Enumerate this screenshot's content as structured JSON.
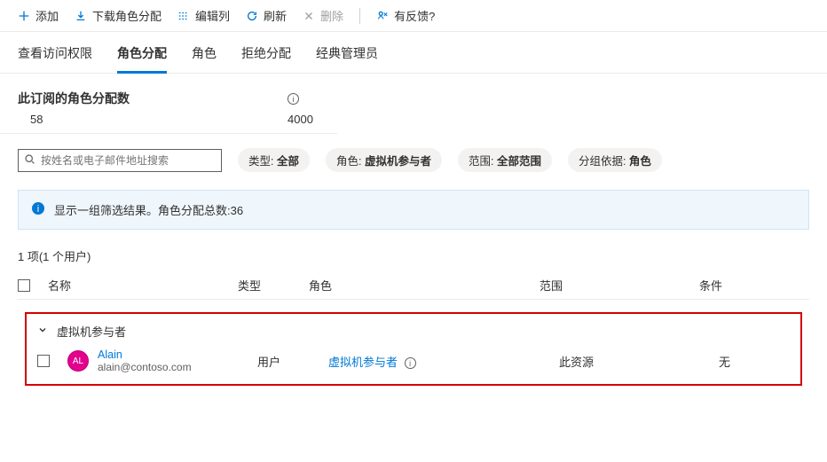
{
  "toolbar": {
    "add": "添加",
    "download": "下载角色分配",
    "editCols": "编辑列",
    "refresh": "刷新",
    "delete": "删除",
    "feedback": "有反馈?"
  },
  "tabs": {
    "access": "查看访问权限",
    "roleAssign": "角色分配",
    "roles": "角色",
    "denyAssign": "拒绝分配",
    "classicAdmin": "经典管理员"
  },
  "stats": {
    "label": "此订阅的角色分配数",
    "current": "58",
    "max": "4000"
  },
  "search": {
    "placeholder": "按姓名或电子邮件地址搜索"
  },
  "filters": {
    "type": {
      "label": "类型",
      "value": "全部"
    },
    "role": {
      "label": "角色",
      "value": "虚拟机参与者"
    },
    "scope": {
      "label": "范围",
      "value": "全部范围"
    },
    "groupBy": {
      "label": "分组依据",
      "value": "角色"
    }
  },
  "banner": "显示一组筛选结果。角色分配总数:36",
  "summary": "1 项(1 个用户)",
  "columns": {
    "name": "名称",
    "type": "类型",
    "role": "角色",
    "scope": "范围",
    "condition": "条件"
  },
  "group": {
    "title": "虚拟机参与者"
  },
  "rows": [
    {
      "avatar": "AL",
      "name": "Alain",
      "email": "alain@contoso.com",
      "type": "用户",
      "role": "虚拟机参与者",
      "scope": "此资源",
      "condition": "无"
    }
  ]
}
